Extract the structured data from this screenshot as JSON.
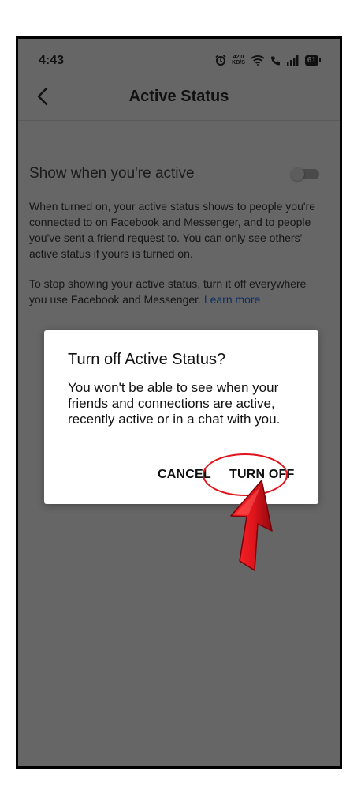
{
  "status_bar": {
    "time": "4:43",
    "net_speed_value": "42.0",
    "net_speed_unit": "KB/S",
    "battery_level": "61"
  },
  "app_bar": {
    "title": "Active Status"
  },
  "setting": {
    "label": "Show when you're active",
    "toggle_state": "off"
  },
  "description": {
    "paragraph1": "When turned on, your active status shows to people you're connected to on Facebook and Messenger, and to people you've sent a friend request to. You can only see others' active status if yours is turned on.",
    "paragraph2": "To stop showing your active status, turn it off everywhere you use Facebook and Messenger.",
    "learn_more": "Learn more"
  },
  "dialog": {
    "title": "Turn off Active Status?",
    "body": "You won't be able to see when your friends and connections are active, recently active or in a chat with you.",
    "cancel_label": "CANCEL",
    "confirm_label": "TURN OFF"
  },
  "colors": {
    "scrim": "#666666",
    "dialog_bg": "#ffffff",
    "annotation_red": "#e0141c",
    "link": "#0d2e63"
  }
}
